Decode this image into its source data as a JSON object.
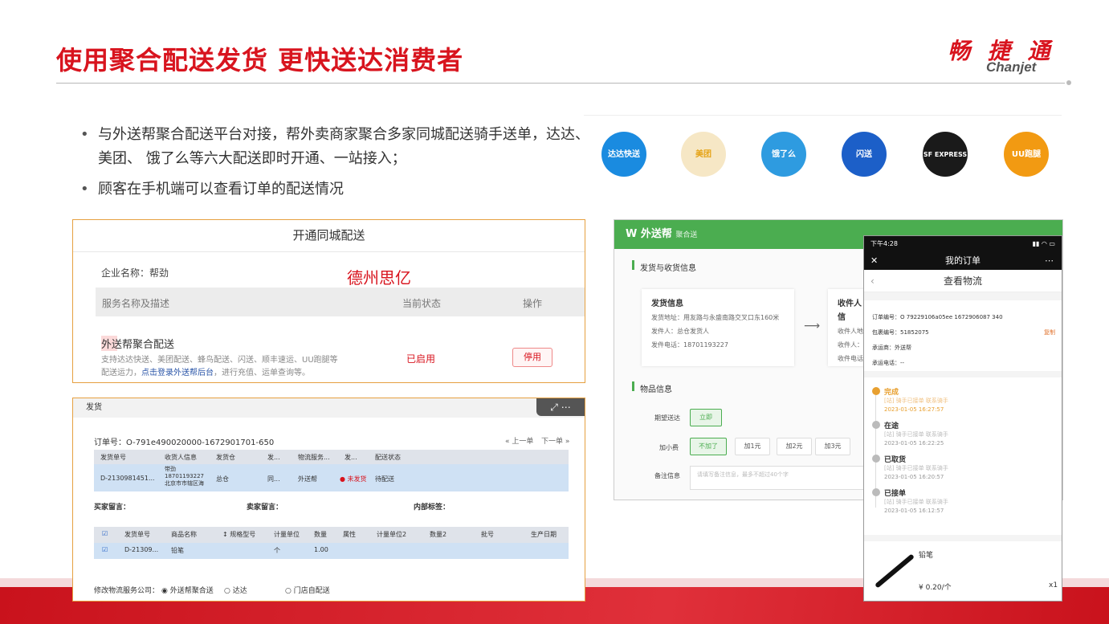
{
  "slide": {
    "title": "使用聚合配送发货 更快送达消费者",
    "logo_cn": "畅 捷 通",
    "logo_en": "Chanjet",
    "bullets": [
      "与外送帮聚合配送平台对接，帮外卖商家聚合多家同城配送骑手送单，达达、 美团、 饿了么等六大配送即时开通、一站接入；",
      "顾客在手机端可以查看订单的配送情况"
    ],
    "partners": [
      {
        "name": "达达快送",
        "color": "#1a8be0"
      },
      {
        "name": "美团",
        "color": "#f6e7c5"
      },
      {
        "name": "饿了么",
        "color": "#2e9be0"
      },
      {
        "name": "闪送",
        "color": "#1c5fc8"
      },
      {
        "name": "SF EXPRESS",
        "color": "#1a1a1a"
      },
      {
        "name": "UU跑腿",
        "color": "#f29a12"
      }
    ],
    "accent": "#d8141e"
  },
  "panel_open": {
    "title": "开通同城配送",
    "company_label": "企业名称：帮劲",
    "overlay": "德州思亿",
    "col_service": "服务名称及描述",
    "col_status": "当前状态",
    "col_action": "操作",
    "service_name": "外送帮聚合配送",
    "desc_pre": "支持达达快送、美团配送、蜂鸟配送、闪送、顺丰速运、UU跑腿等配送运力，",
    "desc_link": "点击登录外送帮后台",
    "desc_post": "，进行充值、运单查询等。",
    "status": "已启用",
    "button": "停用"
  },
  "panel_ship": {
    "header": "发货",
    "order_no": "订单号：O-791e490020000-1672901701-650",
    "prev": "« 上一单",
    "next": "下一单 »",
    "ship_cols": [
      "发货单号",
      "收货人信息",
      "发货仓",
      "发...",
      "物流服务...",
      "发...",
      "配送状态"
    ],
    "ship_row": [
      "D-2130981451...",
      "带劲 18701193227 北京市市辖区海",
      "总仓",
      "同...",
      "外送帮",
      "● 未发货",
      "待配送"
    ],
    "buyer_note": "买家留言：",
    "seller_note": "卖家留言：",
    "tag": "内部标签：",
    "item_cols": [
      "☑",
      "发货单号",
      "商品名称",
      "↕ 规格型号",
      "计量单位",
      "数量",
      "属性",
      "计量单位2",
      "数量2",
      "批号",
      "生产日期"
    ],
    "item_row": [
      "☑",
      "D-21309...",
      "铅笔",
      "",
      "个",
      "1.00",
      "",
      "",
      "",
      "",
      ""
    ],
    "logistics_label": "修改物流服务公司：",
    "opt1": "◉ 外送帮聚合送",
    "opt2": "○ 达达",
    "opt3": "○ 门店自配送"
  },
  "panel_wsb": {
    "brand": "W 外送帮",
    "brand_sub": "聚合送",
    "sec1": "发货与收货信息",
    "send_title": "发货信息",
    "send_addr": "发货地址：用友路与永盛南路交叉口东160米",
    "sender": "发件人：总仓发货人",
    "send_phone": "发件电话：18701193227",
    "recv_title": "收件人信",
    "recv1": "收件人地",
    "recv2": "收件人：",
    "recv3": "收件电话",
    "sec2": "物品信息",
    "expect_label": "期望送达",
    "expect_val": "立即",
    "tip_label": "加小费",
    "tips": [
      "不加了",
      "加1元",
      "加2元",
      "加3元"
    ],
    "note_label": "备注信息",
    "note_ph": "请填写备注信息，最多不超过40个字"
  },
  "phone": {
    "status_time": "下午4:28",
    "nav_title": "我的订单",
    "sub_title": "查看物流",
    "order_no": "订单编号：O 79229106a05ee 1672906087 340",
    "pkg": "包裹编号：51852075",
    "copy": "复制",
    "carrier": "承运商：外送帮",
    "phone": "承运电话：--",
    "steps": [
      {
        "title": "完成",
        "time": "2023-01-05 16:27:57",
        "active": true
      },
      {
        "title": "在途",
        "time": "2023-01-05 16:22:25",
        "active": false
      },
      {
        "title": "已取货",
        "time": "2023-01-05 16:20:57",
        "active": false
      },
      {
        "title": "已接单",
        "time": "2023-01-05 16:12:57",
        "active": false
      }
    ],
    "step_note": "[站] 骑手已接单 联系骑手",
    "item_name": "铅笔",
    "price": "¥ 0.20/个",
    "qty": "x1"
  }
}
